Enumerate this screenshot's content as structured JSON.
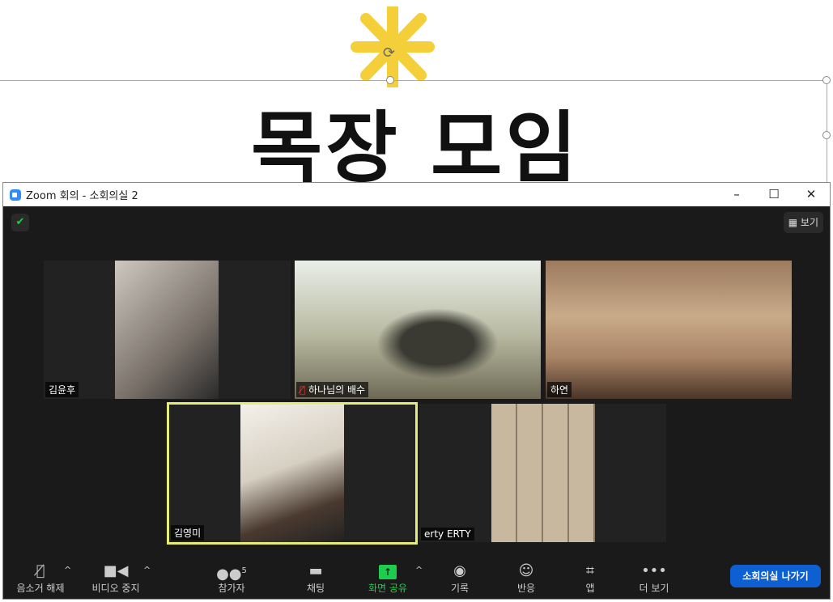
{
  "slide": {
    "title": "목장 모임"
  },
  "window": {
    "title": "Zoom 회의 - 소회의실 2",
    "view_label": "보기"
  },
  "participants": [
    {
      "name": "김윤후",
      "muted": false
    },
    {
      "name": "하나님의 배수",
      "muted": true
    },
    {
      "name": "하연",
      "muted": false
    },
    {
      "name": "김영미",
      "muted": false,
      "active_speaker": true
    },
    {
      "name": "erty ERTY",
      "muted": false
    }
  ],
  "toolbar": {
    "unmute": "음소거 해제",
    "stop_video": "비디오 중지",
    "participants": "참가자",
    "participant_count": "5",
    "chat": "채팅",
    "share": "화면 공유",
    "record": "기록",
    "reactions": "반응",
    "apps": "앱",
    "more": "더 보기",
    "leave": "소회의실 나가기"
  },
  "colors": {
    "accent": "#0e5fd1",
    "share": "#1fcc4d",
    "speaker_border": "#e4ec7a"
  }
}
